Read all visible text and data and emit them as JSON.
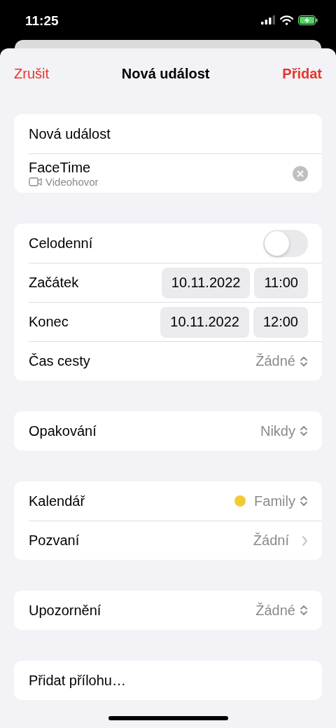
{
  "status_bar": {
    "time": "11:25"
  },
  "nav": {
    "cancel": "Zrušit",
    "title": "Nová událost",
    "add": "Přidat"
  },
  "groups": [
    {
      "rows": [
        {
          "kind": "title",
          "value": "Nová událost"
        },
        {
          "kind": "facetime",
          "label": "FaceTime",
          "subtitle": "Videohovor"
        }
      ]
    },
    {
      "rows": [
        {
          "kind": "toggle",
          "label": "Celodenní",
          "on": false
        },
        {
          "kind": "datetime",
          "label": "Začátek",
          "date": "10.11.2022",
          "time": "11:00"
        },
        {
          "kind": "datetime",
          "label": "Konec",
          "date": "10.11.2022",
          "time": "12:00"
        },
        {
          "kind": "select",
          "label": "Čas cesty",
          "value": "Žádné"
        }
      ]
    },
    {
      "rows": [
        {
          "kind": "select",
          "label": "Opakování",
          "value": "Nikdy"
        }
      ]
    },
    {
      "rows": [
        {
          "kind": "calendar",
          "label": "Kalendář",
          "value": "Family",
          "color": "#f5c936"
        },
        {
          "kind": "link",
          "label": "Pozvaní",
          "value": "Žádní"
        }
      ]
    },
    {
      "rows": [
        {
          "kind": "select",
          "label": "Upozornění",
          "value": "Žádné"
        }
      ]
    },
    {
      "rows": [
        {
          "kind": "action",
          "label": "Přidat přílohu…"
        }
      ]
    }
  ]
}
